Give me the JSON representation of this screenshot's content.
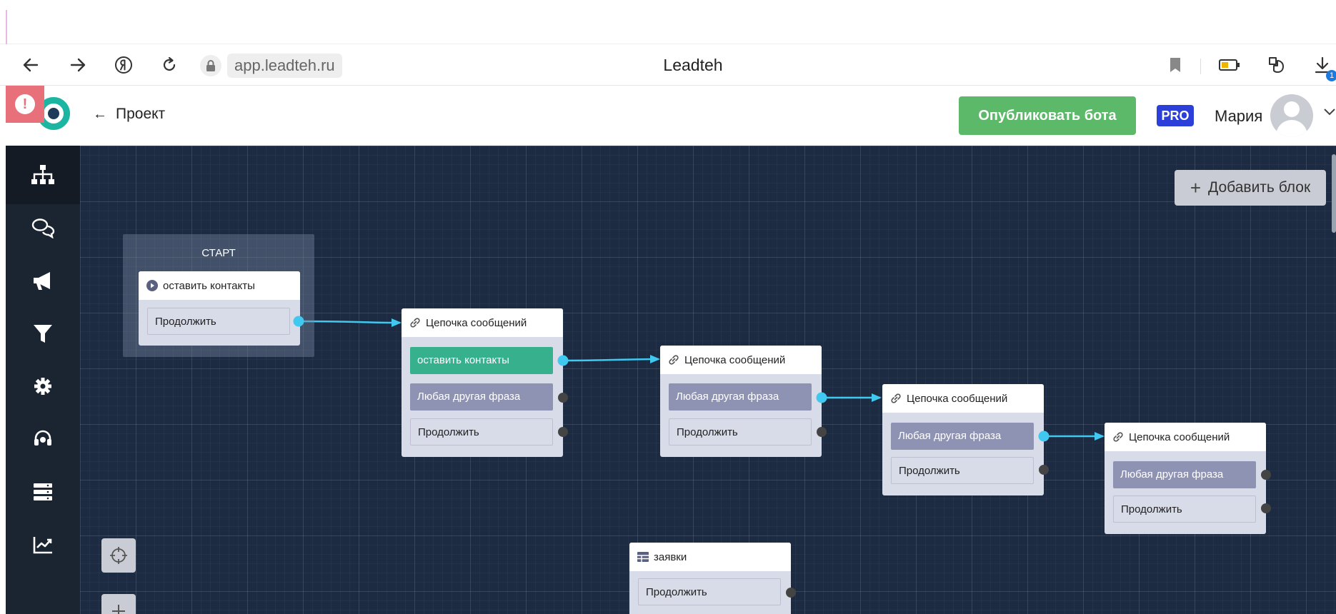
{
  "browser": {
    "url": "app.leadteh.ru",
    "page_title": "Leadteh",
    "download_badge": "1"
  },
  "header": {
    "back_label": "Проект",
    "publish_label": "Опубликовать бота",
    "plan_badge": "PRO",
    "user_name": "Мария"
  },
  "sidebar": {
    "items": [
      {
        "icon": "sitemap-icon"
      },
      {
        "icon": "chat-bubbles-icon"
      },
      {
        "icon": "megaphone-icon"
      },
      {
        "icon": "funnel-icon"
      },
      {
        "icon": "gear-icon"
      },
      {
        "icon": "headset-icon"
      },
      {
        "icon": "database-icon"
      },
      {
        "icon": "chart-line-icon"
      }
    ]
  },
  "canvas": {
    "add_block_label": "Добавить блок",
    "start_group_label": "СТАРТ",
    "nodes": [
      {
        "title": "оставить контакты",
        "rows": [
          "Продолжить"
        ]
      },
      {
        "title": "Цепочка сообщений",
        "rows": [
          "оставить контакты",
          "Любая другая фраза",
          "Продолжить"
        ]
      },
      {
        "title": "Цепочка сообщений",
        "rows": [
          "Любая другая фраза",
          "Продолжить"
        ]
      },
      {
        "title": "Цепочка сообщений",
        "rows": [
          "Любая другая фраза",
          "Продолжить"
        ]
      },
      {
        "title": "Цепочка сообщений",
        "rows": [
          "Любая другая фраза",
          "Продолжить"
        ]
      },
      {
        "title": "заявки",
        "rows": [
          "Продолжить"
        ]
      }
    ]
  },
  "colors": {
    "canvas_bg": "#1c2a42",
    "sidebar_bg": "#1b2431",
    "publish_green": "#5cb96a",
    "pro_blue": "#2d3fd9",
    "connector_cyan": "#40c8f0",
    "row_green": "#37b08d",
    "row_purple": "#8f93b3"
  }
}
